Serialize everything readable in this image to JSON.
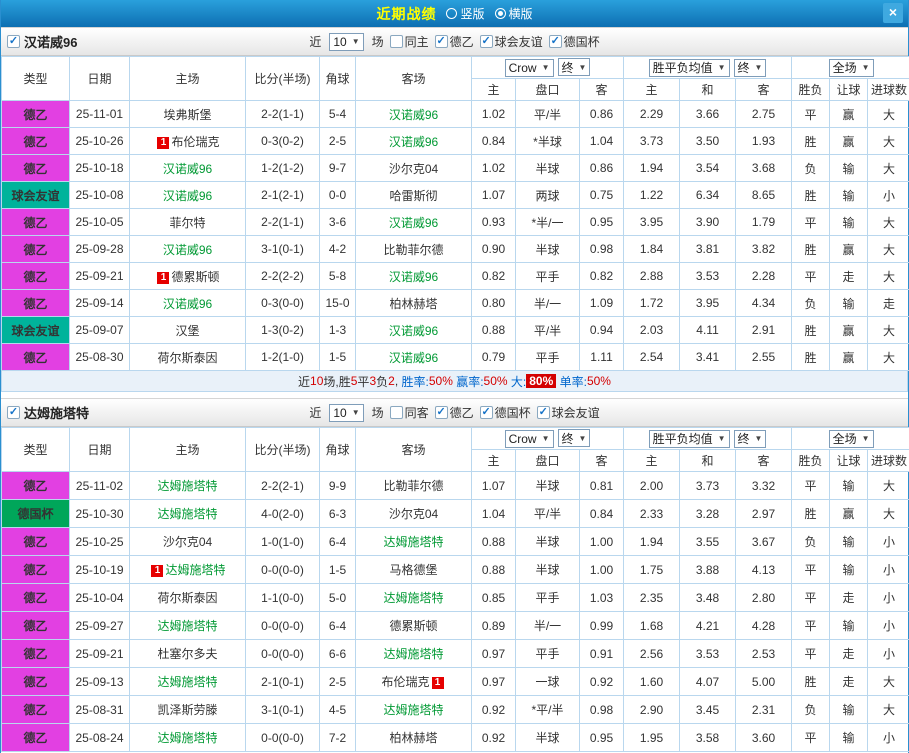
{
  "topbar": {
    "title": "近期战绩",
    "radio_vertical": "竖版",
    "radio_horizontal": "横版",
    "selected": "横版",
    "close_icon": "×"
  },
  "type_colors": {
    "德乙": "#e240e2",
    "球会友谊": "#00b39b",
    "德国杯": "#00a65a"
  },
  "result_colors": {
    "win": "#d40000",
    "draw": "#3366cc",
    "lose": "#009933"
  },
  "table_header": {
    "type": "类型",
    "date": "日期",
    "home": "主场",
    "score": "比分(半场)",
    "corner": "角球",
    "away": "客场",
    "asia_select": "Crow",
    "asia_final": "终",
    "europe_select": "胜平负均值",
    "europe_final": "终",
    "result_select": "全场",
    "sub": [
      "主",
      "盘口",
      "客",
      "主",
      "和",
      "客",
      "胜负",
      "让球",
      "进球数"
    ]
  },
  "sections": [
    {
      "team": "汉诺威96",
      "team_checked": true,
      "near_label": "近",
      "games_value": "10",
      "games_suffix": "场",
      "filters": [
        {
          "label": "同主",
          "checked": false
        },
        {
          "label": "德乙",
          "checked": true
        },
        {
          "label": "球会友谊",
          "checked": true
        },
        {
          "label": "德国杯",
          "checked": true
        }
      ],
      "rows": [
        {
          "type": "德乙",
          "date": "25-11-01",
          "home": "埃弗斯堡",
          "home_f": false,
          "home_b": "",
          "score": "2-2(1-1)",
          "corner": "5-4",
          "away": "汉诺威96",
          "away_f": true,
          "away_b": "",
          "ah": "1.02",
          "hc": "平/半",
          "hred": false,
          "aa": "0.86",
          "eh": "2.29",
          "ed": "3.66",
          "ea": "2.75",
          "res": [
            [
              "平",
              "d"
            ],
            [
              "赢",
              "w"
            ],
            [
              "大",
              "w"
            ]
          ]
        },
        {
          "type": "德乙",
          "date": "25-10-26",
          "home": "布伦瑞克",
          "home_f": false,
          "home_b": "1",
          "score": "0-3(0-2)",
          "corner": "2-5",
          "away": "汉诺威96",
          "away_f": true,
          "away_b": "",
          "ah": "0.84",
          "hc": "*半球",
          "hred": true,
          "aa": "1.04",
          "eh": "3.73",
          "ed": "3.50",
          "ea": "1.93",
          "res": [
            [
              "胜",
              "w"
            ],
            [
              "赢",
              "w"
            ],
            [
              "大",
              "w"
            ]
          ]
        },
        {
          "type": "德乙",
          "date": "25-10-18",
          "home": "汉诺威96",
          "home_f": true,
          "home_b": "",
          "score": "1-2(1-2)",
          "corner": "9-7",
          "away": "沙尔克04",
          "away_f": false,
          "away_b": "",
          "ah": "1.02",
          "hc": "半球",
          "hred": false,
          "aa": "0.86",
          "eh": "1.94",
          "ed": "3.54",
          "ea": "3.68",
          "res": [
            [
              "负",
              "l"
            ],
            [
              "输",
              "l"
            ],
            [
              "大",
              "w"
            ]
          ]
        },
        {
          "type": "球会友谊",
          "date": "25-10-08",
          "home": "汉诺威96",
          "home_f": true,
          "home_b": "",
          "score": "2-1(2-1)",
          "corner": "0-0",
          "away": "哈雷斯彻",
          "away_f": false,
          "away_b": "",
          "ah": "1.07",
          "hc": "两球",
          "hred": false,
          "aa": "0.75",
          "eh": "1.22",
          "ed": "6.34",
          "ea": "8.65",
          "res": [
            [
              "胜",
              "w"
            ],
            [
              "输",
              "l"
            ],
            [
              "小",
              "l"
            ]
          ]
        },
        {
          "type": "德乙",
          "date": "25-10-05",
          "home": "菲尔特",
          "home_f": false,
          "home_b": "",
          "score": "2-2(1-1)",
          "corner": "3-6",
          "away": "汉诺威96",
          "away_f": true,
          "away_b": "",
          "ah": "0.93",
          "hc": "*半/一",
          "hred": true,
          "aa": "0.95",
          "eh": "3.95",
          "ed": "3.90",
          "ea": "1.79",
          "res": [
            [
              "平",
              "d"
            ],
            [
              "输",
              "l"
            ],
            [
              "大",
              "w"
            ]
          ]
        },
        {
          "type": "德乙",
          "date": "25-09-28",
          "home": "汉诺威96",
          "home_f": true,
          "home_b": "",
          "score": "3-1(0-1)",
          "corner": "4-2",
          "away": "比勒菲尔德",
          "away_f": false,
          "away_b": "",
          "ah": "0.90",
          "hc": "半球",
          "hred": false,
          "aa": "0.98",
          "eh": "1.84",
          "ed": "3.81",
          "ea": "3.82",
          "res": [
            [
              "胜",
              "w"
            ],
            [
              "赢",
              "w"
            ],
            [
              "大",
              "w"
            ]
          ]
        },
        {
          "type": "德乙",
          "date": "25-09-21",
          "home": "德累斯顿",
          "home_f": false,
          "home_b": "1",
          "score": "2-2(2-2)",
          "corner": "5-8",
          "away": "汉诺威96",
          "away_f": true,
          "away_b": "",
          "ah": "0.82",
          "hc": "平手",
          "hred": false,
          "aa": "0.82",
          "eh": "2.88",
          "ed": "3.53",
          "ea": "2.28",
          "res": [
            [
              "平",
              "d"
            ],
            [
              "走",
              "d"
            ],
            [
              "大",
              "w"
            ]
          ]
        },
        {
          "type": "德乙",
          "date": "25-09-14",
          "home": "汉诺威96",
          "home_f": true,
          "home_b": "",
          "score": "0-3(0-0)",
          "corner": "15-0",
          "away": "柏林赫塔",
          "away_f": false,
          "away_b": "",
          "ah": "0.80",
          "hc": "半/一",
          "hred": false,
          "aa": "1.09",
          "eh": "1.72",
          "ed": "3.95",
          "ea": "4.34",
          "res": [
            [
              "负",
              "l"
            ],
            [
              "输",
              "l"
            ],
            [
              "走",
              "d"
            ]
          ]
        },
        {
          "type": "球会友谊",
          "date": "25-09-07",
          "home": "汉堡",
          "home_f": false,
          "home_b": "",
          "score": "1-3(0-2)",
          "corner": "1-3",
          "away": "汉诺威96",
          "away_f": true,
          "away_b": "",
          "ah": "0.88",
          "hc": "平/半",
          "hred": false,
          "aa": "0.94",
          "eh": "2.03",
          "ed": "4.11",
          "ea": "2.91",
          "res": [
            [
              "胜",
              "w"
            ],
            [
              "赢",
              "w"
            ],
            [
              "大",
              "w"
            ]
          ]
        },
        {
          "type": "德乙",
          "date": "25-08-30",
          "home": "荷尔斯泰因",
          "home_f": false,
          "home_b": "",
          "score": "1-2(1-0)",
          "corner": "1-5",
          "away": "汉诺威96",
          "away_f": true,
          "away_b": "",
          "ah": "0.79",
          "hc": "平手",
          "hred": false,
          "aa": "1.11",
          "eh": "2.54",
          "ed": "3.41",
          "ea": "2.55",
          "res": [
            [
              "胜",
              "w"
            ],
            [
              "赢",
              "w"
            ],
            [
              "大",
              "w"
            ]
          ]
        }
      ],
      "summary": [
        {
          "t": "近",
          "c": "dark"
        },
        {
          "t": "10",
          "c": "red"
        },
        {
          "t": "场,胜",
          "c": "dark"
        },
        {
          "t": "5",
          "c": "red"
        },
        {
          "t": "平",
          "c": "dark"
        },
        {
          "t": "3",
          "c": "red"
        },
        {
          "t": "负",
          "c": "dark"
        },
        {
          "t": "2",
          "c": "red"
        },
        {
          "t": ", ",
          "c": "dark"
        },
        {
          "t": "胜率:",
          "c": "blue"
        },
        {
          "t": "50%",
          "c": "red"
        },
        {
          "t": " 赢率:",
          "c": "blue"
        },
        {
          "t": "50%",
          "c": "red"
        },
        {
          "t": " 大:",
          "c": "blue"
        },
        {
          "t": "80%",
          "c": "hl"
        },
        {
          "t": " 单率:",
          "c": "blue"
        },
        {
          "t": "50%",
          "c": "red"
        }
      ]
    },
    {
      "team": "达姆施塔特",
      "team_checked": true,
      "near_label": "近",
      "games_value": "10",
      "games_suffix": "场",
      "filters": [
        {
          "label": "同客",
          "checked": false
        },
        {
          "label": "德乙",
          "checked": true
        },
        {
          "label": "德国杯",
          "checked": true
        },
        {
          "label": "球会友谊",
          "checked": true
        }
      ],
      "rows": [
        {
          "type": "德乙",
          "date": "25-11-02",
          "home": "达姆施塔特",
          "home_f": true,
          "home_b": "",
          "score": "2-2(2-1)",
          "corner": "9-9",
          "away": "比勒菲尔德",
          "away_f": false,
          "away_b": "",
          "ah": "1.07",
          "hc": "半球",
          "hred": false,
          "aa": "0.81",
          "eh": "2.00",
          "ed": "3.73",
          "ea": "3.32",
          "res": [
            [
              "平",
              "d"
            ],
            [
              "输",
              "l"
            ],
            [
              "大",
              "w"
            ]
          ]
        },
        {
          "type": "德国杯",
          "date": "25-10-30",
          "home": "达姆施塔特",
          "home_f": true,
          "home_b": "",
          "score": "4-0(2-0)",
          "corner": "6-3",
          "away": "沙尔克04",
          "away_f": false,
          "away_b": "",
          "ah": "1.04",
          "hc": "平/半",
          "hred": false,
          "aa": "0.84",
          "eh": "2.33",
          "ed": "3.28",
          "ea": "2.97",
          "res": [
            [
              "胜",
              "w"
            ],
            [
              "赢",
              "w"
            ],
            [
              "大",
              "w"
            ]
          ]
        },
        {
          "type": "德乙",
          "date": "25-10-25",
          "home": "沙尔克04",
          "home_f": false,
          "home_b": "",
          "score": "1-0(1-0)",
          "corner": "6-4",
          "away": "达姆施塔特",
          "away_f": true,
          "away_b": "",
          "ah": "0.88",
          "hc": "半球",
          "hred": false,
          "aa": "1.00",
          "eh": "1.94",
          "ed": "3.55",
          "ea": "3.67",
          "res": [
            [
              "负",
              "l"
            ],
            [
              "输",
              "l"
            ],
            [
              "小",
              "l"
            ]
          ]
        },
        {
          "type": "德乙",
          "date": "25-10-19",
          "home": "达姆施塔特",
          "home_f": true,
          "home_b": "1",
          "score": "0-0(0-0)",
          "corner": "1-5",
          "away": "马格德堡",
          "away_f": false,
          "away_b": "",
          "ah": "0.88",
          "hc": "半球",
          "hred": false,
          "aa": "1.00",
          "eh": "1.75",
          "ed": "3.88",
          "ea": "4.13",
          "res": [
            [
              "平",
              "d"
            ],
            [
              "输",
              "l"
            ],
            [
              "小",
              "l"
            ]
          ]
        },
        {
          "type": "德乙",
          "date": "25-10-04",
          "home": "荷尔斯泰因",
          "home_f": false,
          "home_b": "",
          "score": "1-1(0-0)",
          "corner": "5-0",
          "away": "达姆施塔特",
          "away_f": true,
          "away_b": "",
          "ah": "0.85",
          "hc": "平手",
          "hred": false,
          "aa": "1.03",
          "eh": "2.35",
          "ed": "3.48",
          "ea": "2.80",
          "res": [
            [
              "平",
              "d"
            ],
            [
              "走",
              "d"
            ],
            [
              "小",
              "l"
            ]
          ]
        },
        {
          "type": "德乙",
          "date": "25-09-27",
          "home": "达姆施塔特",
          "home_f": true,
          "home_b": "",
          "score": "0-0(0-0)",
          "corner": "6-4",
          "away": "德累斯顿",
          "away_f": false,
          "away_b": "",
          "ah": "0.89",
          "hc": "半/一",
          "hred": false,
          "aa": "0.99",
          "eh": "1.68",
          "ed": "4.21",
          "ea": "4.28",
          "res": [
            [
              "平",
              "d"
            ],
            [
              "输",
              "l"
            ],
            [
              "小",
              "l"
            ]
          ]
        },
        {
          "type": "德乙",
          "date": "25-09-21",
          "home": "杜塞尔多夫",
          "home_f": false,
          "home_b": "",
          "score": "0-0(0-0)",
          "corner": "6-6",
          "away": "达姆施塔特",
          "away_f": true,
          "away_b": "",
          "ah": "0.97",
          "hc": "平手",
          "hred": false,
          "aa": "0.91",
          "eh": "2.56",
          "ed": "3.53",
          "ea": "2.53",
          "res": [
            [
              "平",
              "d"
            ],
            [
              "走",
              "d"
            ],
            [
              "小",
              "l"
            ]
          ]
        },
        {
          "type": "德乙",
          "date": "25-09-13",
          "home": "达姆施塔特",
          "home_f": true,
          "home_b": "",
          "score": "2-1(0-1)",
          "corner": "2-5",
          "away": "布伦瑞克",
          "away_f": false,
          "away_b": "1",
          "ah": "0.97",
          "hc": "一球",
          "hred": false,
          "aa": "0.92",
          "eh": "1.60",
          "ed": "4.07",
          "ea": "5.00",
          "res": [
            [
              "胜",
              "w"
            ],
            [
              "走",
              "d"
            ],
            [
              "大",
              "w"
            ]
          ]
        },
        {
          "type": "德乙",
          "date": "25-08-31",
          "home": "凯泽斯劳滕",
          "home_f": false,
          "home_b": "",
          "score": "3-1(0-1)",
          "corner": "4-5",
          "away": "达姆施塔特",
          "away_f": true,
          "away_b": "",
          "ah": "0.92",
          "hc": "*平/半",
          "hred": true,
          "aa": "0.98",
          "eh": "2.90",
          "ed": "3.45",
          "ea": "2.31",
          "res": [
            [
              "负",
              "l"
            ],
            [
              "输",
              "l"
            ],
            [
              "大",
              "w"
            ]
          ]
        },
        {
          "type": "德乙",
          "date": "25-08-24",
          "home": "达姆施塔特",
          "home_f": true,
          "home_b": "",
          "score": "0-0(0-0)",
          "corner": "7-2",
          "away": "柏林赫塔",
          "away_f": false,
          "away_b": "",
          "ah": "0.92",
          "hc": "半球",
          "hred": false,
          "aa": "0.95",
          "eh": "1.95",
          "ed": "3.58",
          "ea": "3.60",
          "res": [
            [
              "平",
              "d"
            ],
            [
              "输",
              "l"
            ],
            [
              "小",
              "l"
            ]
          ]
        }
      ],
      "summary": null
    }
  ]
}
